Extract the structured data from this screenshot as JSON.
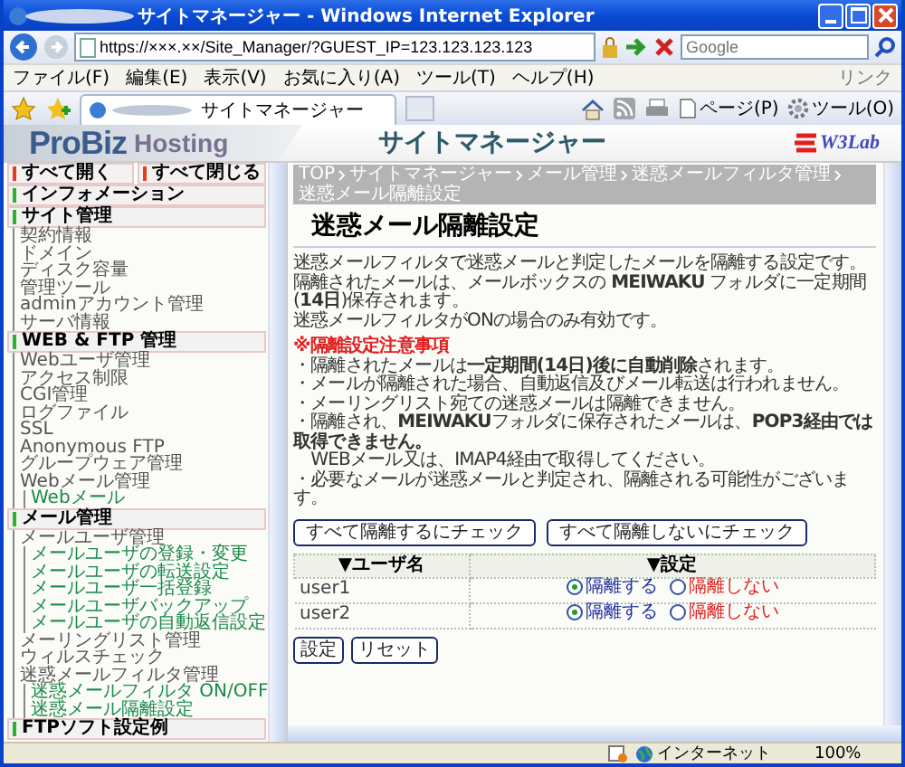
{
  "browser": {
    "title": "サイトマネージャー - Windows Internet Explorer",
    "address": "https://×××.××/Site_Manager/?GUEST_IP=123.123.123.123",
    "search_placeholder": "Google",
    "menu": [
      "ファイル(F)",
      "編集(E)",
      "表示(V)",
      "お気に入り(A)",
      "ツール(T)",
      "ヘルプ(H)"
    ],
    "links_label": "リンク",
    "tab_title": "サイトマネージャー",
    "toolbar": [
      "ページ(P)",
      "ツール(O)"
    ],
    "status": "インターネット",
    "zoom": "100%"
  },
  "banner": {
    "logo_main": "ProBiz",
    "logo_sub": "Hosting",
    "title": "サイトマネージャー",
    "brand": "W3Lab"
  },
  "sidebar": {
    "expand_all": "すべて開く",
    "collapse_all": "すべて閉じる",
    "sections": [
      {
        "title": "インフォメーション"
      },
      {
        "title": "サイト管理",
        "items": [
          {
            "label": "契約情報"
          },
          {
            "label": "ドメイン"
          },
          {
            "label": "ディスク容量"
          },
          {
            "label": "管理ツール"
          },
          {
            "label": "adminアカウント管理"
          },
          {
            "label": "サーバ情報"
          }
        ]
      },
      {
        "title": "WEB & FTP 管理",
        "items": [
          {
            "label": "Webユーザ管理"
          },
          {
            "label": "アクセス制限"
          },
          {
            "label": "CGI管理"
          },
          {
            "label": "ログファイル"
          },
          {
            "label": "SSL"
          },
          {
            "label": "Anonymous FTP"
          },
          {
            "label": "グループウェア管理"
          },
          {
            "label": "Webメール管理",
            "children": [
              {
                "label": "Webメール"
              }
            ]
          }
        ]
      },
      {
        "title": "メール管理",
        "items": [
          {
            "label": "メールユーザ管理",
            "children": [
              {
                "label": "メールユーザの登録・変更"
              },
              {
                "label": "メールユーザの転送設定"
              },
              {
                "label": "メールユーザ一括登録"
              },
              {
                "label": "メールユーザバックアップ"
              },
              {
                "label": "メールユーザの自動返信設定"
              }
            ]
          },
          {
            "label": "メーリングリスト管理"
          },
          {
            "label": "ウィルスチェック"
          },
          {
            "label": "迷惑メールフィルタ管理",
            "children": [
              {
                "label": "迷惑メールフィルタ ON/OFF"
              },
              {
                "label": "迷惑メール隔離設定"
              }
            ]
          }
        ]
      },
      {
        "title": "FTPソフト設定例"
      }
    ]
  },
  "breadcrumb": [
    "TOP",
    "サイトマネージャー",
    "メール管理",
    "迷惑メールフィルタ管理",
    "迷惑メール隔離設定"
  ],
  "page_title": "迷惑メール隔離設定",
  "intro": [
    "迷惑メールフィルタで迷惑メールと判定したメールを隔離する設定です。",
    "隔離されたメールは、メールボックスの **MEIWAKU** フォルダに一定期間(**14日**)保存されます。",
    "迷惑メールフィルタがONの場合のみ有効です。"
  ],
  "notes_heading": "※隔離設定注意事項",
  "notes": [
    "・隔離されたメールは**一定期間(14日)後に自動削除**されます。",
    "・メールが隔離された場合、自動返信及びメール転送は行われません。",
    "・メーリングリスト宛ての迷惑メールは隔離できません。",
    "・隔離され、**MEIWAKU**フォルダに保存されたメールは、**POP3経由では取得できません。**",
    "　WEBメール又は、IMAP4経由で取得してください。",
    "・必要なメールが迷惑メールと判定され、隔離される可能性がございます。"
  ],
  "bulk_buttons": [
    "すべて隔離するにチェック",
    "すべて隔離しないにチェック"
  ],
  "table": {
    "columns": [
      "▼ユーザ名",
      "▼設定"
    ],
    "rows": [
      {
        "user": "user1",
        "options": [
          {
            "label": "隔離する",
            "selected": true
          },
          {
            "label": "隔離しない",
            "selected": false
          }
        ]
      },
      {
        "user": "user2",
        "options": [
          {
            "label": "隔離する",
            "selected": true
          },
          {
            "label": "隔離しない",
            "selected": false
          }
        ]
      }
    ]
  },
  "form_buttons": [
    "設定",
    "リセット"
  ]
}
